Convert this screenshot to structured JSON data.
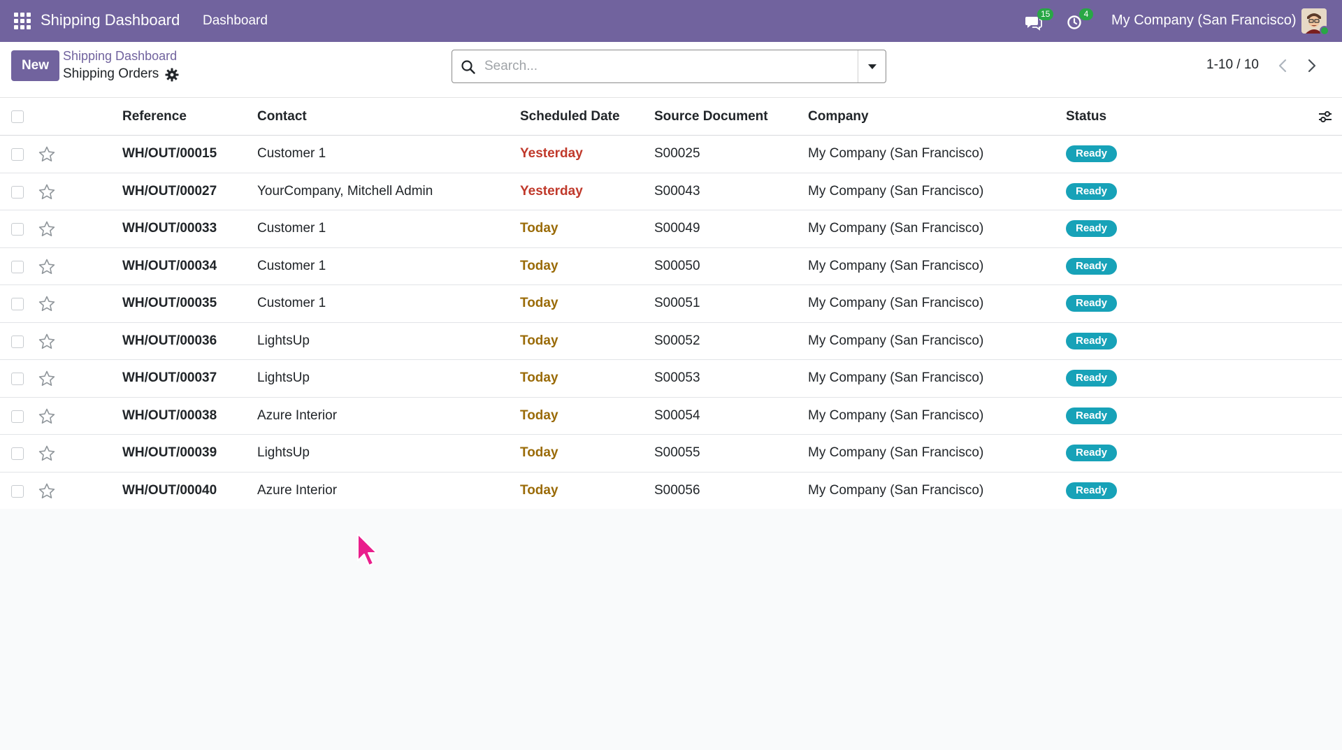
{
  "navbar": {
    "app_name": "Shipping Dashboard",
    "menu_item": "Dashboard",
    "messages_count": "15",
    "activities_count": "4",
    "company": "My Company (San Francisco)",
    "bg_color": "#71639e"
  },
  "control_panel": {
    "new_label": "New",
    "breadcrumb_parent": "Shipping Dashboard",
    "breadcrumb_current": "Shipping Orders",
    "search_placeholder": "Search...",
    "pager": "1-10 / 10"
  },
  "table": {
    "headers": {
      "reference": "Reference",
      "contact": "Contact",
      "scheduled_date": "Scheduled Date",
      "source_document": "Source Document",
      "company": "Company",
      "status": "Status"
    },
    "rows": [
      {
        "reference": "WH/OUT/00015",
        "contact": "Customer 1",
        "date": "Yesterday",
        "date_state": "late",
        "source": "S00025",
        "company": "My Company (San Francisco)",
        "status": "Ready"
      },
      {
        "reference": "WH/OUT/00027",
        "contact": "YourCompany, Mitchell Admin",
        "date": "Yesterday",
        "date_state": "late",
        "source": "S00043",
        "company": "My Company (San Francisco)",
        "status": "Ready"
      },
      {
        "reference": "WH/OUT/00033",
        "contact": "Customer 1",
        "date": "Today",
        "date_state": "today",
        "source": "S00049",
        "company": "My Company (San Francisco)",
        "status": "Ready"
      },
      {
        "reference": "WH/OUT/00034",
        "contact": "Customer 1",
        "date": "Today",
        "date_state": "today",
        "source": "S00050",
        "company": "My Company (San Francisco)",
        "status": "Ready"
      },
      {
        "reference": "WH/OUT/00035",
        "contact": "Customer 1",
        "date": "Today",
        "date_state": "today",
        "source": "S00051",
        "company": "My Company (San Francisco)",
        "status": "Ready"
      },
      {
        "reference": "WH/OUT/00036",
        "contact": "LightsUp",
        "date": "Today",
        "date_state": "today",
        "source": "S00052",
        "company": "My Company (San Francisco)",
        "status": "Ready"
      },
      {
        "reference": "WH/OUT/00037",
        "contact": "LightsUp",
        "date": "Today",
        "date_state": "today",
        "source": "S00053",
        "company": "My Company (San Francisco)",
        "status": "Ready"
      },
      {
        "reference": "WH/OUT/00038",
        "contact": "Azure Interior",
        "date": "Today",
        "date_state": "today",
        "source": "S00054",
        "company": "My Company (San Francisco)",
        "status": "Ready"
      },
      {
        "reference": "WH/OUT/00039",
        "contact": "LightsUp",
        "date": "Today",
        "date_state": "today",
        "source": "S00055",
        "company": "My Company (San Francisco)",
        "status": "Ready"
      },
      {
        "reference": "WH/OUT/00040",
        "contact": "Azure Interior",
        "date": "Today",
        "date_state": "today",
        "source": "S00056",
        "company": "My Company (San Francisco)",
        "status": "Ready"
      }
    ]
  },
  "colors": {
    "late_date": "#c0392b",
    "today_date": "#9a6b08",
    "status_ready": "#17a2b8",
    "cursor": "#e91e8c"
  }
}
